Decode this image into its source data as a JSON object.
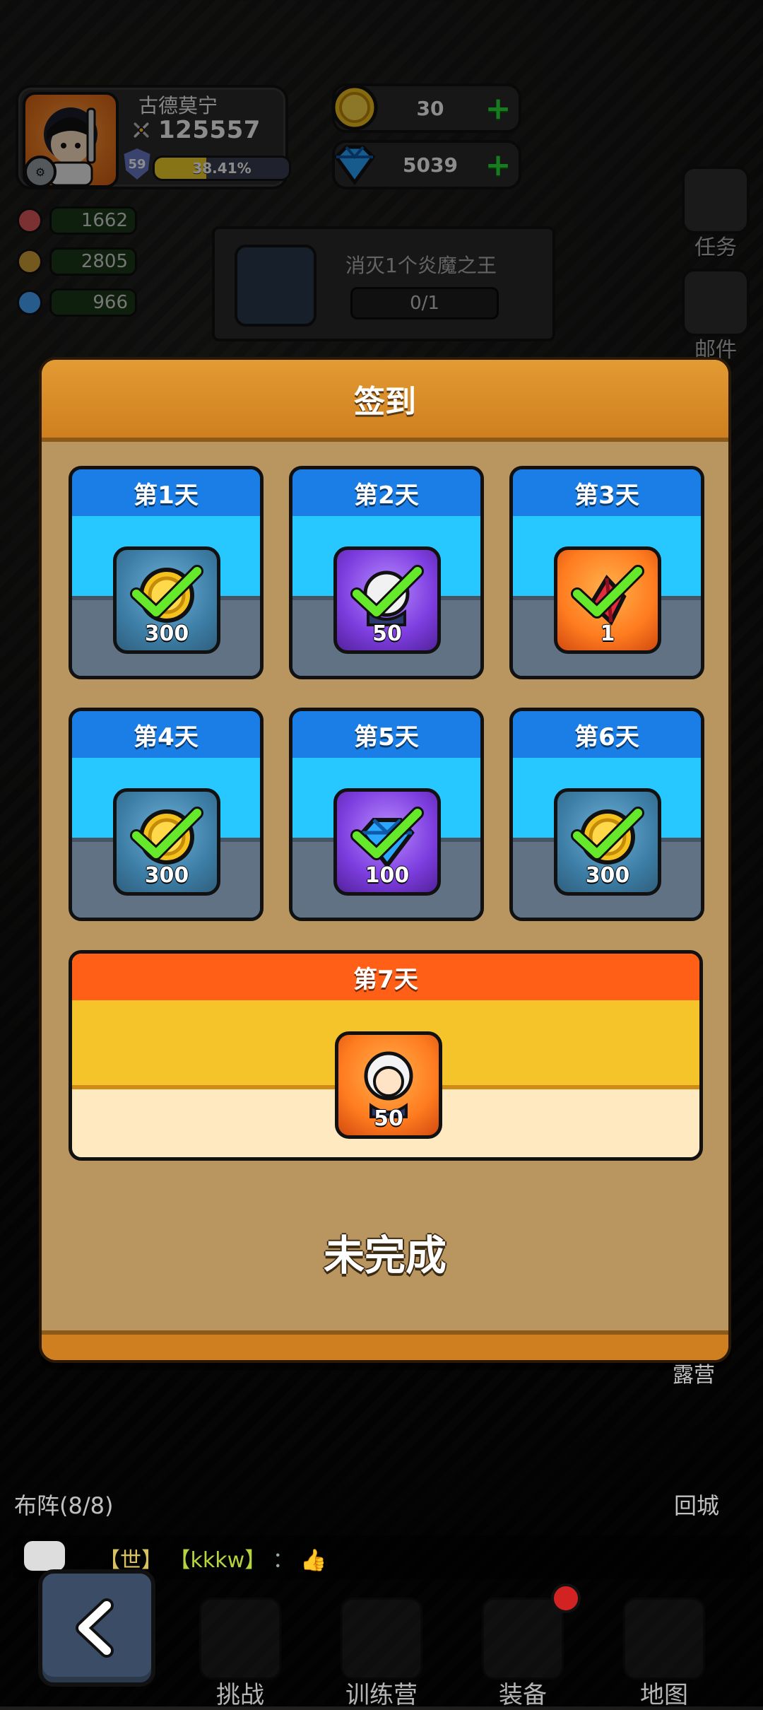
{
  "profile": {
    "name": "古德莫宁",
    "power": "125557",
    "level": "59",
    "xp_percent_text": "38.41%",
    "xp_percent": 38.41
  },
  "currencies": [
    {
      "name": "gold",
      "amount": "30",
      "icon": "gold-coin-icon"
    },
    {
      "name": "diamond",
      "amount": "5039",
      "icon": "diamond-icon"
    }
  ],
  "left_resources": [
    {
      "amount": "1662",
      "color": "#e05a5a"
    },
    {
      "amount": "2805",
      "color": "#d4a33a"
    },
    {
      "amount": "966",
      "color": "#47a7ff"
    }
  ],
  "task": {
    "title": "消灭1个炎魔之王",
    "progress": "0/1"
  },
  "right_menu": [
    {
      "label": "任务",
      "icon": "task-clipboard-icon"
    },
    {
      "label": "邮件",
      "icon": "mail-icon"
    }
  ],
  "modal": {
    "title": "签到",
    "days": [
      {
        "label": "第1天",
        "qty": "300",
        "type": "coin",
        "claimed": true
      },
      {
        "label": "第2天",
        "qty": "50",
        "type": "hero-token",
        "claimed": true
      },
      {
        "label": "第3天",
        "qty": "1",
        "type": "red-crystal",
        "claimed": true
      },
      {
        "label": "第4天",
        "qty": "300",
        "type": "coin",
        "claimed": true
      },
      {
        "label": "第5天",
        "qty": "100",
        "type": "diamond",
        "claimed": true
      },
      {
        "label": "第6天",
        "qty": "300",
        "type": "coin",
        "claimed": true
      }
    ],
    "day7": {
      "label": "第7天",
      "qty": "50",
      "type": "hero-portrait",
      "claimed": false
    },
    "status": "未完成"
  },
  "bottom": {
    "formation": "布阵(8/8)",
    "return_city": "回城",
    "camp": "露营",
    "chat": {
      "channel": "【世】",
      "name": "【kkkw】",
      "sep": "：",
      "emoji": "👍"
    },
    "nav": [
      {
        "label": "挑战",
        "icon": "sword-icon"
      },
      {
        "label": "训练营",
        "icon": "target-icon"
      },
      {
        "label": "装备",
        "icon": "armor-icon"
      },
      {
        "label": "地图",
        "icon": "map-icon"
      }
    ]
  },
  "colors": {
    "modal_bg": "#b9955f",
    "modal_header": "#e39b33",
    "card_blue": "#1a7ee6",
    "card_sky": "#27c8ff",
    "check_green": "#66e82b",
    "day7_orange": "#ff5f16",
    "day7_yellow": "#f5c42a"
  }
}
